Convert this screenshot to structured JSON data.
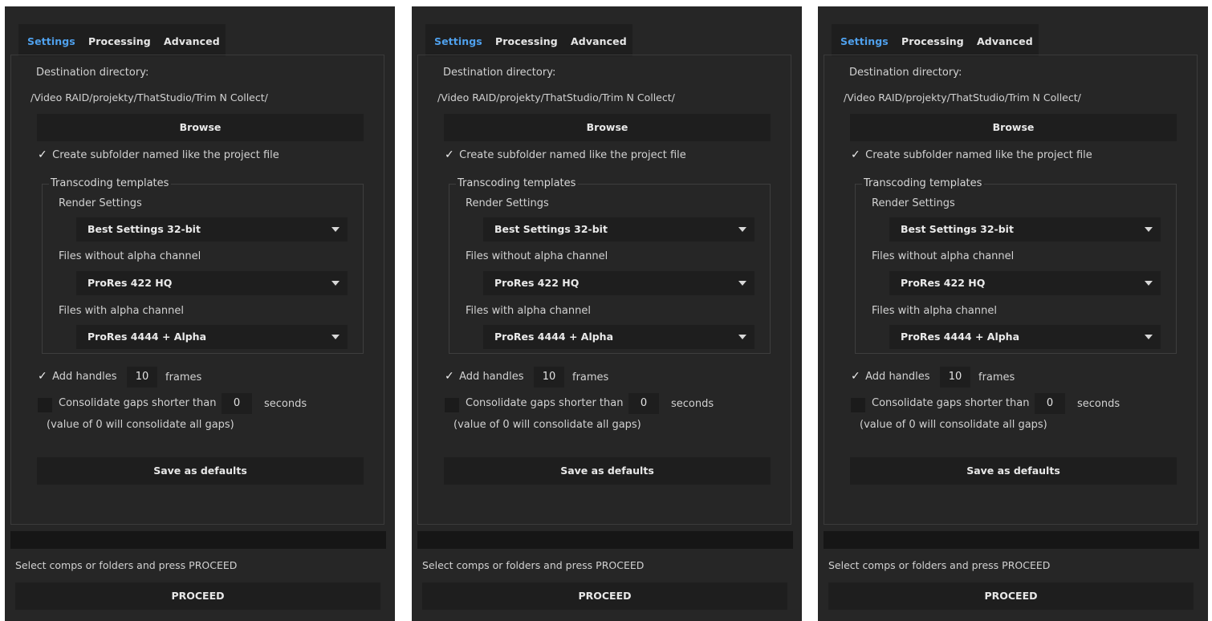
{
  "panels": [
    {
      "tabs": [
        "Settings",
        "Processing",
        "Advanced"
      ],
      "destination_label": "Destination directory:",
      "destination_path": "/Video RAID/projekty/ThatStudio/Trim N Collect/",
      "browse_label": "Browse",
      "subfolder_checkbox": {
        "label": "Create subfolder named like the project file",
        "checked": true,
        "check_glyph": "✓"
      },
      "group_title": "Transcoding templates",
      "render_settings": {
        "label": "Render Settings",
        "value": "Best Settings 32-bit"
      },
      "without_alpha": {
        "label": "Files without alpha channel",
        "value": "ProRes 422 HQ"
      },
      "with_alpha": {
        "label": "Files with alpha channel",
        "value": "ProRes 4444 + Alpha"
      },
      "handles": {
        "label": "Add handles",
        "value": "10",
        "unit": "frames",
        "checked": true,
        "check_glyph": "✓"
      },
      "consolidate": {
        "label": "Consolidate gaps shorter than",
        "value": "0",
        "unit": "seconds",
        "note": "(value of 0 will consolidate all gaps)",
        "checked": false
      },
      "save_defaults_label": "Save as defaults",
      "status_text": "Select comps or folders and press PROCEED",
      "proceed_label": "PROCEED"
    },
    {
      "tabs": [
        "Settings",
        "Processing",
        "Advanced"
      ],
      "destination_label": "Destination directory:",
      "destination_path": "/Video RAID/projekty/ThatStudio/Trim N Collect/",
      "browse_label": "Browse",
      "subfolder_checkbox": {
        "label": "Create subfolder named like the project file",
        "checked": true,
        "check_glyph": "✓"
      },
      "group_title": "Transcoding templates",
      "render_settings": {
        "label": "Render Settings",
        "value": "Best Settings 32-bit"
      },
      "without_alpha": {
        "label": "Files without alpha channel",
        "value": "ProRes 422 HQ"
      },
      "with_alpha": {
        "label": "Files with alpha channel",
        "value": "ProRes 4444 + Alpha"
      },
      "handles": {
        "label": "Add handles",
        "value": "10",
        "unit": "frames",
        "checked": true,
        "check_glyph": "✓"
      },
      "consolidate": {
        "label": "Consolidate gaps shorter than",
        "value": "0",
        "unit": "seconds",
        "note": "(value of 0 will consolidate all gaps)",
        "checked": false
      },
      "save_defaults_label": "Save as defaults",
      "status_text": "Select comps or folders and press PROCEED",
      "proceed_label": "PROCEED"
    },
    {
      "tabs": [
        "Settings",
        "Processing",
        "Advanced"
      ],
      "destination_label": "Destination directory:",
      "destination_path": "/Video RAID/projekty/ThatStudio/Trim N Collect/",
      "browse_label": "Browse",
      "subfolder_checkbox": {
        "label": "Create subfolder named like the project file",
        "checked": true,
        "check_glyph": "✓"
      },
      "group_title": "Transcoding templates",
      "render_settings": {
        "label": "Render Settings",
        "value": "Best Settings 32-bit"
      },
      "without_alpha": {
        "label": "Files without alpha channel",
        "value": "ProRes 422 HQ"
      },
      "with_alpha": {
        "label": "Files with alpha channel",
        "value": "ProRes 4444 + Alpha"
      },
      "handles": {
        "label": "Add handles",
        "value": "10",
        "unit": "frames",
        "checked": true,
        "check_glyph": "✓"
      },
      "consolidate": {
        "label": "Consolidate gaps shorter than",
        "value": "0",
        "unit": "seconds",
        "note": "(value of 0 will consolidate all gaps)",
        "checked": false
      },
      "save_defaults_label": "Save as defaults",
      "status_text": "Select comps or folders and press PROCEED",
      "proceed_label": "PROCEED"
    }
  ],
  "colors": {
    "panel_bg": "#262626",
    "control_bg": "#1e1e1e",
    "active_tab": "#4fa0ec",
    "text": "#d2d2d2"
  },
  "icons": {
    "dropdown": "chevron-down-icon",
    "check": "checkmark-icon"
  }
}
